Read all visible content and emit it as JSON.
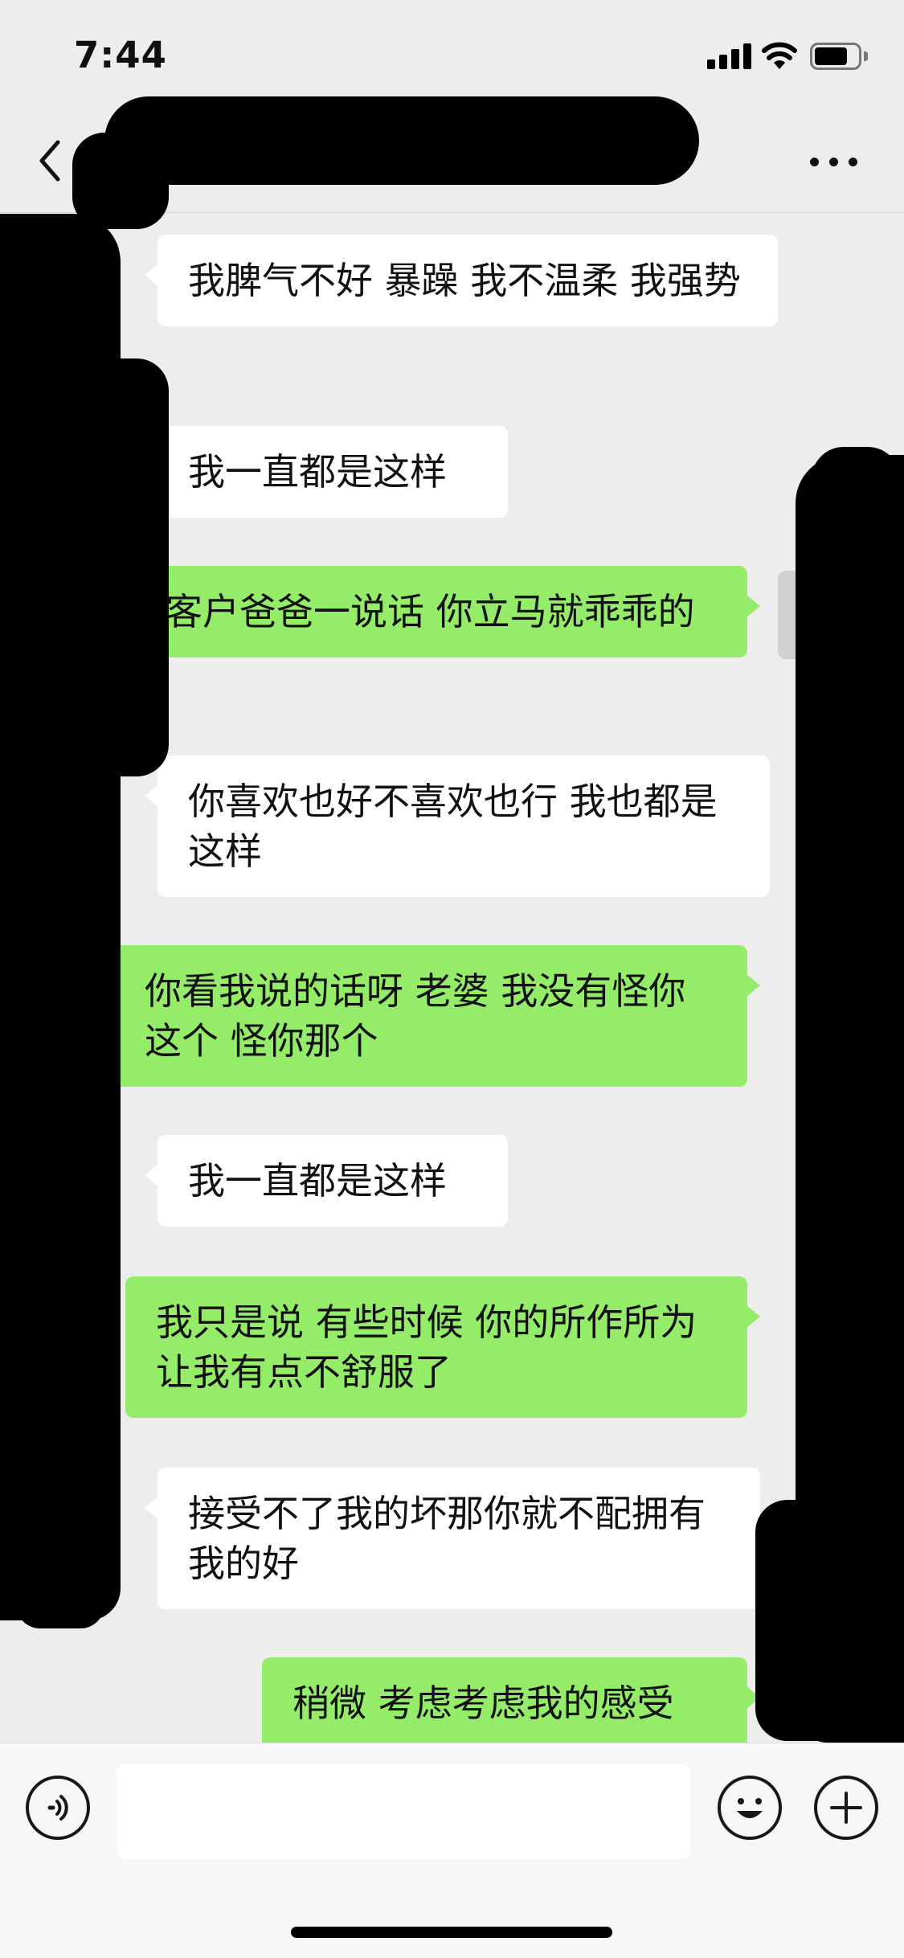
{
  "status_bar": {
    "time": "7:44",
    "icons": [
      "cellular-signal-icon",
      "wifi-icon",
      "battery-icon"
    ]
  },
  "nav": {
    "back_icon": "chevron-left-icon",
    "title": "",
    "more_icon": "ellipsis-icon"
  },
  "messages": [
    {
      "side": "in",
      "text": "我脾气不好 暴躁   我不温柔  我强势"
    },
    {
      "side": "in",
      "text": "我一直都是这样"
    },
    {
      "side": "out",
      "text": "客户爸爸一说话 你立马就乖乖的"
    },
    {
      "side": "in",
      "text": "你喜欢也好不喜欢也行 我也都是这样"
    },
    {
      "side": "out",
      "text": "你看我说的话呀 老婆  我没有怪你这个 怪你那个"
    },
    {
      "side": "in",
      "text": "我一直都是这样"
    },
    {
      "side": "out",
      "text": "我只是说 有些时候 你的所作所为 让我有点不舒服了"
    },
    {
      "side": "in",
      "text": "接受不了我的坏那你就不配拥有我的好"
    },
    {
      "side": "out",
      "text": "稍微 考虑考虑我的感受"
    }
  ],
  "input_bar": {
    "voice_icon": "voice-icon",
    "input_value": "",
    "emoji_icon": "emoji-icon",
    "plus_icon": "plus-icon"
  },
  "colors": {
    "background": "#ededed",
    "incoming_bubble": "#ffffff",
    "outgoing_bubble": "#95ec69",
    "redaction": "#000000"
  }
}
